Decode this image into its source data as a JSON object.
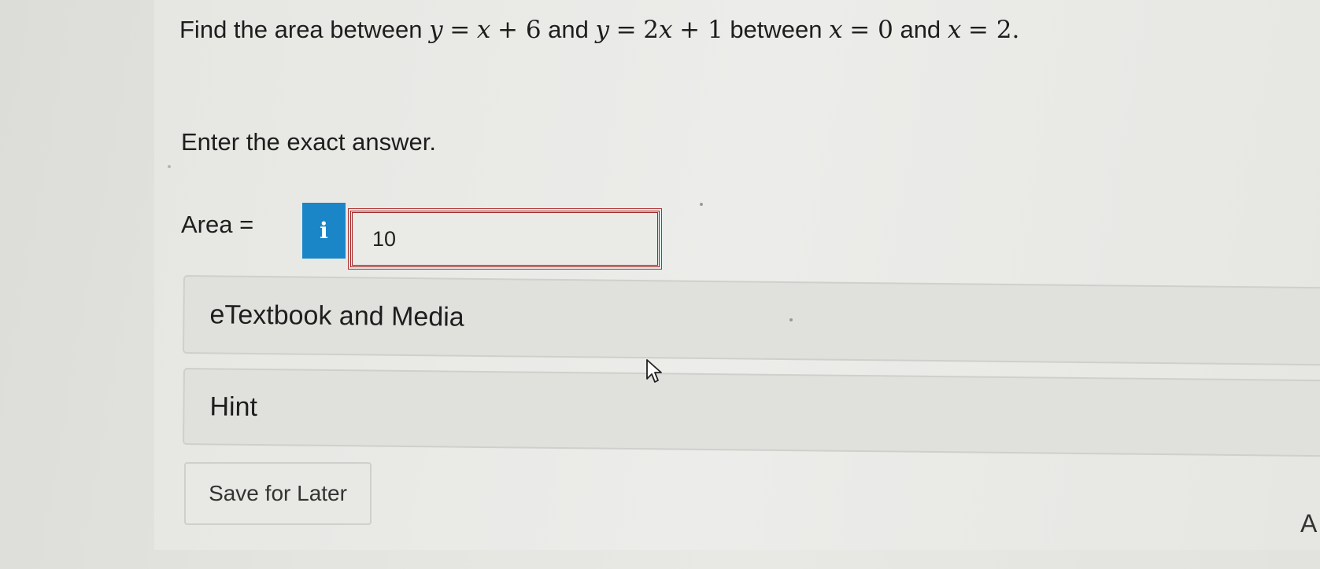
{
  "question": {
    "find": "Find the area between",
    "eq1_y": "y",
    "eq1_eq": "=",
    "eq1_x": "x",
    "eq1_rest": "+ 6",
    "and1": "and",
    "eq2_y": "y",
    "eq2_eq": "=",
    "eq2_coef": "2",
    "eq2_x": "x",
    "eq2_rest": "+ 1",
    "between": "between",
    "b1_x": "x",
    "b1_rest": "= 0",
    "and2": "and",
    "b2_x": "x",
    "b2_rest": "= 2."
  },
  "instruction": "Enter the exact answer.",
  "answer": {
    "label": "Area =",
    "info_glyph": "i",
    "value": "10"
  },
  "panels": {
    "etextbook": "eTextbook and Media",
    "hint": "Hint"
  },
  "save_button": "Save for Later",
  "edge_text": "A",
  "colors": {
    "info_button": "#1a86c8",
    "answer_border": "#a02525"
  },
  "icons": {
    "info": "info-icon",
    "cursor": "mouse-pointer-icon"
  }
}
